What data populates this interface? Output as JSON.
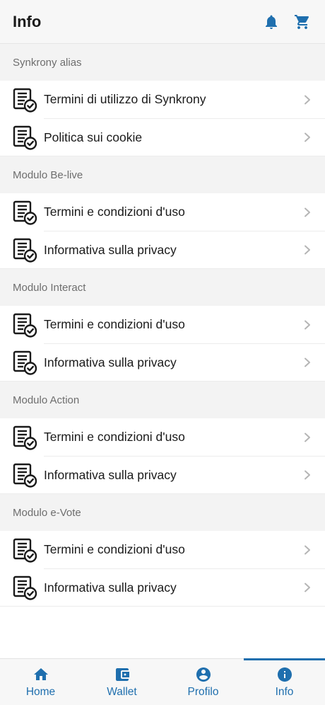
{
  "appbar": {
    "title": "Info",
    "icons": [
      "bell-icon",
      "cart-icon"
    ],
    "accent_color": "#1f6fae"
  },
  "sections": [
    {
      "header": "Synkrony alias",
      "items": [
        {
          "label": "Termini di utilizzo di Synkrony",
          "icon": "document-check-icon"
        },
        {
          "label": "Politica sui cookie",
          "icon": "document-check-icon"
        }
      ]
    },
    {
      "header": "Modulo Be-live",
      "items": [
        {
          "label": "Termini e condizioni d'uso",
          "icon": "document-check-icon"
        },
        {
          "label": "Informativa sulla privacy",
          "icon": "document-check-icon"
        }
      ]
    },
    {
      "header": "Modulo Interact",
      "items": [
        {
          "label": "Termini e condizioni d'uso",
          "icon": "document-check-icon"
        },
        {
          "label": "Informativa sulla privacy",
          "icon": "document-check-icon"
        }
      ]
    },
    {
      "header": "Modulo Action",
      "items": [
        {
          "label": "Termini e condizioni d'uso",
          "icon": "document-check-icon"
        },
        {
          "label": "Informativa sulla privacy",
          "icon": "document-check-icon"
        }
      ]
    },
    {
      "header": "Modulo e-Vote",
      "items": [
        {
          "label": "Termini e condizioni d'uso",
          "icon": "document-check-icon"
        },
        {
          "label": "Informativa sulla privacy",
          "icon": "document-check-icon"
        }
      ]
    }
  ],
  "bottom_nav": {
    "active": "Info",
    "items": [
      {
        "label": "Home",
        "icon": "home-icon"
      },
      {
        "label": "Wallet",
        "icon": "wallet-icon"
      },
      {
        "label": "Profilo",
        "icon": "profile-icon"
      },
      {
        "label": "Info",
        "icon": "info-icon"
      }
    ]
  }
}
